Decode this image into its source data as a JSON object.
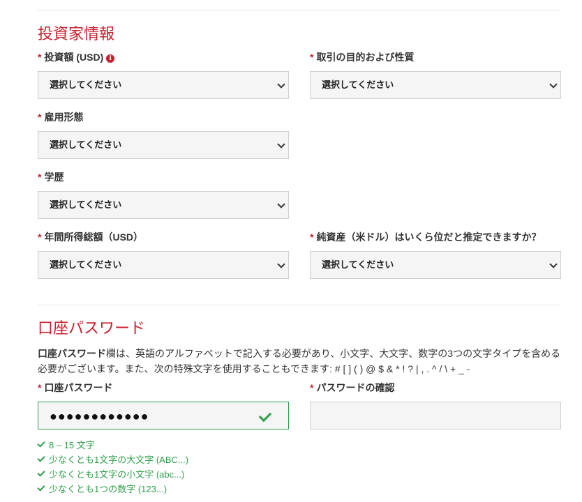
{
  "investor_section": {
    "title": "投資家情報",
    "fields": {
      "investment_amount": {
        "label": "投資額 (USD)",
        "value": "選択してください"
      },
      "trade_purpose": {
        "label": "取引の目的および性質",
        "value": "選択してください"
      },
      "employment": {
        "label": "雇用形態",
        "value": "選択してください"
      },
      "education": {
        "label": "学歴",
        "value": "選択してください"
      },
      "annual_income": {
        "label": "年間所得総額（USD）",
        "value": "選択してください"
      },
      "net_worth": {
        "label": "純資産（米ドル）はいくら位だと推定できますか？",
        "value": "選択してください"
      }
    },
    "required_mark": "*",
    "info_icon_glyph": "i"
  },
  "password_section": {
    "title": "口座パスワード",
    "desc_bold": "口座パスワード",
    "desc_text": "欄は、英語のアルファベットで記入する必要があり、小文字、大文字、数字の3つの文字タイプを含める必要がございます。また、次の特殊文字を使用することもできます: # [ ] ( ) @ $ & * ! ? | , . ^ / \\ + _ -",
    "password_label": "口座パスワード",
    "password_value": "●●●●●●●●●●●●",
    "confirm_label": "パスワードの確認",
    "confirm_value": "",
    "rules": [
      "8 – 15 文字",
      "少なくとも1文字の大文字 (ABC...)",
      "少なくとも1文字の小文字 (abc...)",
      "少なくとも1つの数字 (123...)"
    ]
  },
  "colors": {
    "accent_red": "#c8202f",
    "success_green": "#2e9e4a",
    "field_bg": "#f5f5f5"
  },
  "icons": [
    "info-icon",
    "chevron-down-icon",
    "check-icon"
  ]
}
